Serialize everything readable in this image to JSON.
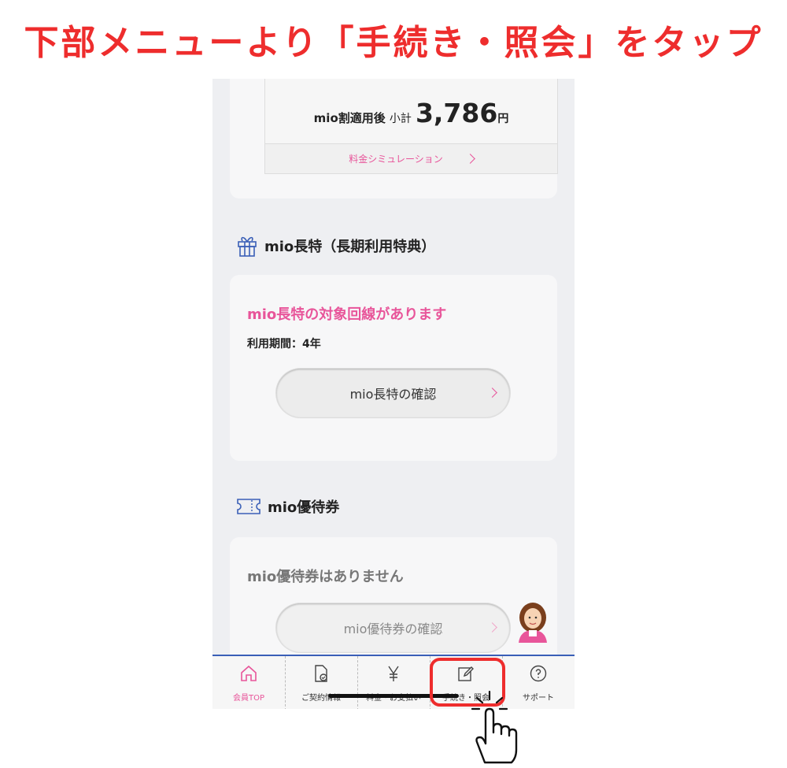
{
  "headline": "下部メニューより「手続き・照会」をタップ",
  "summary": {
    "label": "mio割適用後",
    "small_label": "小計",
    "amount": "3,786",
    "unit": "円",
    "simulation_link": "料金シミュレーション"
  },
  "longterm": {
    "section_title": "mio長特（長期利用特典）",
    "status": "mio長特の対象回線があります",
    "period": "利用期間：4年",
    "button": "mio長特の確認"
  },
  "coupon": {
    "section_title": "mio優待券",
    "status": "mio優待券はありません",
    "button": "mio優待券の確認"
  },
  "tabbar": {
    "items": [
      {
        "label": "会員TOP",
        "icon": "home-icon",
        "active": true
      },
      {
        "label": "ご契約情報",
        "icon": "contract-icon",
        "active": false
      },
      {
        "label": "料金・お支払い",
        "icon": "yen-icon",
        "active": false
      },
      {
        "label": "手続き・照会",
        "icon": "edit-icon",
        "active": false
      },
      {
        "label": "サポート",
        "icon": "help-icon",
        "active": false
      }
    ]
  },
  "colors": {
    "accent": "#e8559a",
    "headline": "#ee2d2d",
    "tabbar_border": "#3a5fb7"
  }
}
